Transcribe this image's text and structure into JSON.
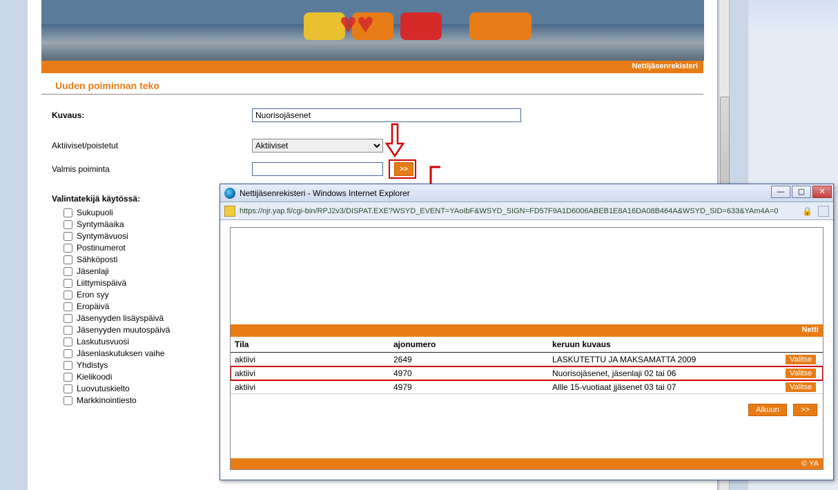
{
  "hero_bar": {
    "label": "Nettijäsenrekisteri"
  },
  "page_title": "Uuden poiminnan teko",
  "form": {
    "kuvaus_label": "Kuvaus:",
    "kuvaus_value": "Nuorisojäsenet",
    "aktiiviset_label": "Aktiiviset/poistetut",
    "aktiiviset_selected": "Aktiiviset",
    "valmis_label": "Valmis poiminta",
    "valmis_value": "",
    "go_btn": ">>"
  },
  "valinta_header": "Valintatekijä käytössä:",
  "valinta": [
    "Sukupuoli",
    "Syntymäaika",
    "Syntymävuosi",
    "Postinumerot",
    "Sähköposti",
    "Jäsenlaji",
    "Liittymispäivä",
    "Eron syy",
    "Eropäivä",
    "Jäsenyyden lisäyspäivä",
    "Jäsenyyden muutospäivä",
    "Laskutusvuosi",
    "Jäsenlaskutuksen vaihe",
    "Yhdistys",
    "Kielikoodi",
    "Luovutuskielto",
    "Markkinointiesto"
  ],
  "ie": {
    "title": "Nettijäsenrekisteri - Windows Internet Explorer",
    "url": "https://njr.yap.fi/cgi-bin/RPJ2v3/DISPAT.EXE?WSYD_EVENT=YAoIbF&WSYD_SIGN=FD57F9A1D6006ABEB1E8A16DA08B464A&WSYD_SID=633&YAm4A=0",
    "bar_label": "Netti",
    "table": {
      "headers": {
        "tila": "Tila",
        "ajonumero": "ajonumero",
        "kuvaus": "keruun kuvaus",
        "action": "Valitse"
      },
      "rows": [
        {
          "tila": "aktiivi",
          "ajonumero": "2649",
          "kuvaus": "LASKUTETTU JA MAKSAMATTA 2009"
        },
        {
          "tila": "aktiivi",
          "ajonumero": "4970",
          "kuvaus": "Nuorisojäsenet, jäsenlaji 02 tai 06"
        },
        {
          "tila": "aktiivi",
          "ajonumero": "4979",
          "kuvaus": "Allle 15-vuotiaat jjäsenet 03 tai 07"
        }
      ]
    },
    "footer": {
      "alkuun": "Alkuun",
      "next": ">>",
      "copy": "© YA"
    }
  }
}
